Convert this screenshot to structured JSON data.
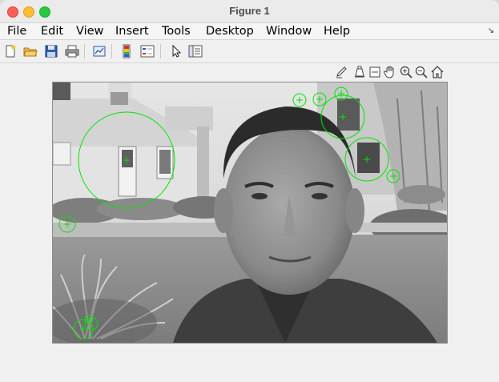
{
  "window": {
    "title": "Figure 1"
  },
  "menubar": {
    "items": [
      "File",
      "Edit",
      "View",
      "Insert",
      "Tools",
      "Desktop",
      "Window",
      "Help"
    ]
  },
  "toolbar": {
    "buttons": [
      "new-figure",
      "open-file",
      "save",
      "print",
      "link-plot",
      "insert-colorbar",
      "insert-legend",
      "edit-plot",
      "property-inspector"
    ]
  },
  "axes_toolbar": {
    "buttons": [
      "brush",
      "data-tips",
      "rotate",
      "pan",
      "zoom-in",
      "zoom-out",
      "restore-view"
    ]
  },
  "image": {
    "description": "grayscale photo",
    "feature_marker_color": "#00e600"
  }
}
